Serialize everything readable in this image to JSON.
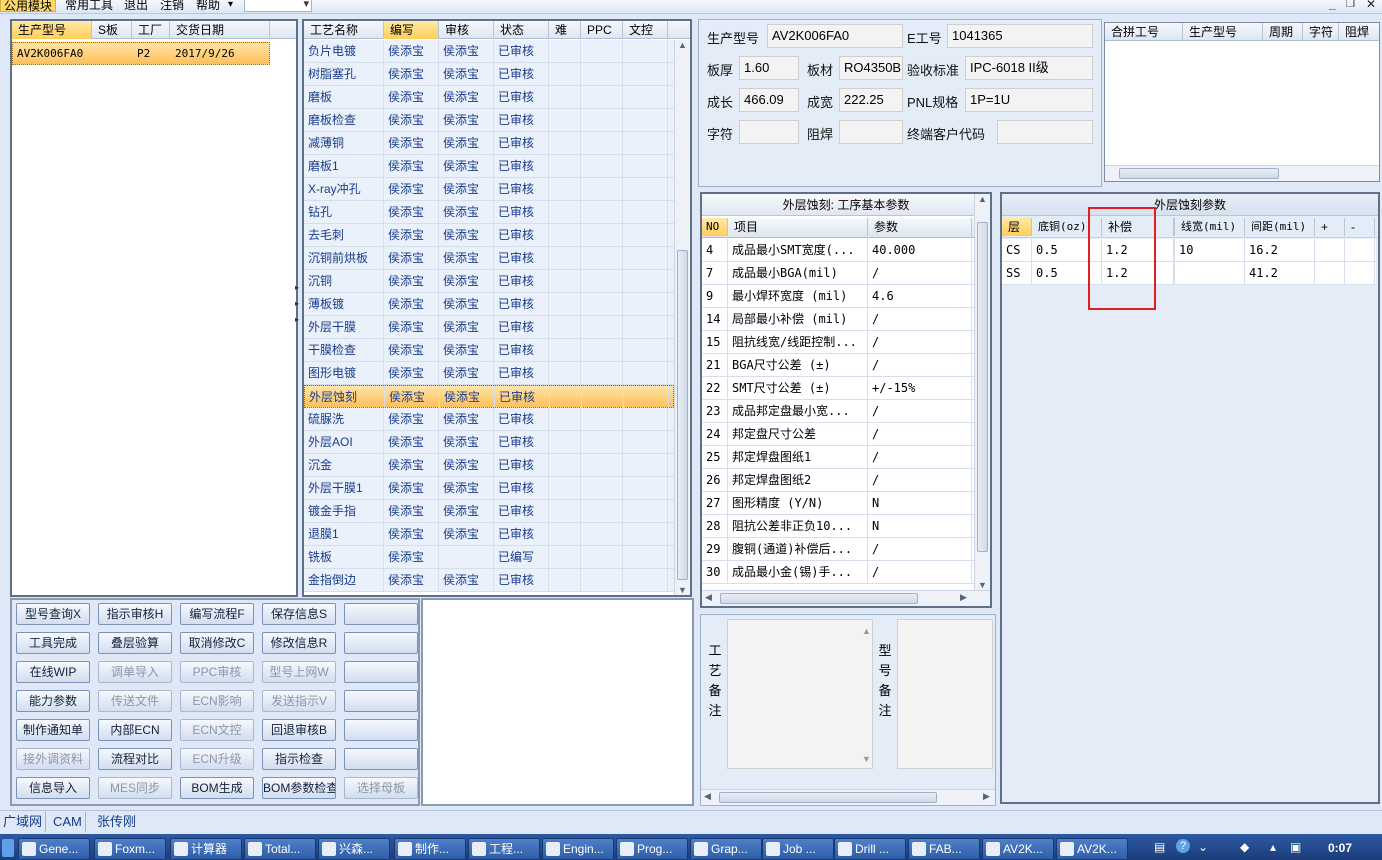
{
  "menu": {
    "items": [
      "公用模块",
      "常用工具",
      "退出",
      "注销",
      "帮助"
    ],
    "help_arrow": "▾"
  },
  "orders": {
    "headers": [
      "生产型号",
      "S板",
      "工厂",
      "交货日期"
    ],
    "rows": [
      {
        "model": "AV2K006FA0",
        "s": "",
        "factory": "P2",
        "date": "2017/9/26"
      }
    ]
  },
  "process": {
    "headers": [
      "工艺名称",
      "编写",
      "审核",
      "状态",
      "难",
      "PPC",
      "文控"
    ],
    "rows": [
      {
        "name": "负片电镀",
        "writer": "侯添宝",
        "reviewer": "侯添宝",
        "status": "已审核"
      },
      {
        "name": "树脂塞孔",
        "writer": "侯添宝",
        "reviewer": "侯添宝",
        "status": "已审核"
      },
      {
        "name": "磨板",
        "writer": "侯添宝",
        "reviewer": "侯添宝",
        "status": "已审核"
      },
      {
        "name": "磨板检查",
        "writer": "侯添宝",
        "reviewer": "侯添宝",
        "status": "已审核"
      },
      {
        "name": "减薄铜",
        "writer": "侯添宝",
        "reviewer": "侯添宝",
        "status": "已审核"
      },
      {
        "name": "磨板1",
        "writer": "侯添宝",
        "reviewer": "侯添宝",
        "status": "已审核"
      },
      {
        "name": "X-ray冲孔",
        "writer": "侯添宝",
        "reviewer": "侯添宝",
        "status": "已审核"
      },
      {
        "name": "钻孔",
        "writer": "侯添宝",
        "reviewer": "侯添宝",
        "status": "已审核"
      },
      {
        "name": "去毛刺",
        "writer": "侯添宝",
        "reviewer": "侯添宝",
        "status": "已审核"
      },
      {
        "name": "沉铜前烘板",
        "writer": "侯添宝",
        "reviewer": "侯添宝",
        "status": "已审核"
      },
      {
        "name": "沉铜",
        "writer": "侯添宝",
        "reviewer": "侯添宝",
        "status": "已审核"
      },
      {
        "name": "薄板镀",
        "writer": "侯添宝",
        "reviewer": "侯添宝",
        "status": "已审核"
      },
      {
        "name": "外层干膜",
        "writer": "侯添宝",
        "reviewer": "侯添宝",
        "status": "已审核"
      },
      {
        "name": "干膜检查",
        "writer": "侯添宝",
        "reviewer": "侯添宝",
        "status": "已审核"
      },
      {
        "name": "图形电镀",
        "writer": "侯添宝",
        "reviewer": "侯添宝",
        "status": "已审核"
      },
      {
        "name": "外层蚀刻",
        "writer": "侯添宝",
        "reviewer": "侯添宝",
        "status": "已审核",
        "selected": true
      },
      {
        "name": "硫脲洗",
        "writer": "侯添宝",
        "reviewer": "侯添宝",
        "status": "已审核"
      },
      {
        "name": "外层AOI",
        "writer": "侯添宝",
        "reviewer": "侯添宝",
        "status": "已审核"
      },
      {
        "name": "沉金",
        "writer": "侯添宝",
        "reviewer": "侯添宝",
        "status": "已审核"
      },
      {
        "name": "外层干膜1",
        "writer": "侯添宝",
        "reviewer": "侯添宝",
        "status": "已审核"
      },
      {
        "name": "镀金手指",
        "writer": "侯添宝",
        "reviewer": "侯添宝",
        "status": "已审核"
      },
      {
        "name": "退膜1",
        "writer": "侯添宝",
        "reviewer": "侯添宝",
        "status": "已审核"
      },
      {
        "name": "铣板",
        "writer": "侯添宝",
        "reviewer": "",
        "status": "已编写"
      },
      {
        "name": "金指倒边",
        "writer": "侯添宝",
        "reviewer": "侯添宝",
        "status": "已审核"
      }
    ]
  },
  "buttons": [
    {
      "label": "型号查询X",
      "enabled": true
    },
    {
      "label": "指示审核H",
      "enabled": true
    },
    {
      "label": "编写流程F",
      "enabled": true
    },
    {
      "label": "保存信息S",
      "enabled": true
    },
    {
      "label": "",
      "enabled": true
    },
    {
      "label": "工具完成",
      "enabled": true
    },
    {
      "label": "叠层验算",
      "enabled": true
    },
    {
      "label": "取消修改C",
      "enabled": true
    },
    {
      "label": "修改信息R",
      "enabled": true
    },
    {
      "label": "",
      "enabled": true
    },
    {
      "label": "在线WIP",
      "enabled": true
    },
    {
      "label": "调单导入",
      "enabled": false
    },
    {
      "label": "PPC审核",
      "enabled": false
    },
    {
      "label": "型号上网W",
      "enabled": false
    },
    {
      "label": "",
      "enabled": true
    },
    {
      "label": "能力参数",
      "enabled": true
    },
    {
      "label": "传送文件",
      "enabled": false
    },
    {
      "label": "ECN影响",
      "enabled": false
    },
    {
      "label": "发送指示V",
      "enabled": false
    },
    {
      "label": "",
      "enabled": true
    },
    {
      "label": "制作通知单",
      "enabled": true
    },
    {
      "label": "内部ECN",
      "enabled": true
    },
    {
      "label": "ECN文控",
      "enabled": false
    },
    {
      "label": "回退审核B",
      "enabled": true
    },
    {
      "label": "",
      "enabled": true
    },
    {
      "label": "接外调资料",
      "enabled": false
    },
    {
      "label": "流程对比",
      "enabled": true
    },
    {
      "label": "ECN升级",
      "enabled": false
    },
    {
      "label": "指示检查",
      "enabled": true
    },
    {
      "label": "",
      "enabled": true
    },
    {
      "label": "信息导入",
      "enabled": true
    },
    {
      "label": "MES同步",
      "enabled": false
    },
    {
      "label": "BOM生成",
      "enabled": true
    },
    {
      "label": "BOM参数检查",
      "enabled": true
    },
    {
      "label": "选择母板",
      "enabled": false
    }
  ],
  "info": {
    "model_label": "生产型号",
    "model_value": "AV2K006FA0",
    "ework_label": "E工号",
    "ework_value": "1041365",
    "thick_label": "板厚",
    "thick_value": "1.60",
    "material_label": "板材",
    "material_value": "RO4350B",
    "accept_label": "验收标准",
    "accept_value": "IPC-6018 II级",
    "length_label": "成长",
    "length_value": "466.09",
    "width_label": "成宽",
    "width_value": "222.25",
    "pnl_label": "PNL规格",
    "pnl_value": "1P=1U",
    "char_label": "字符",
    "char_value": "",
    "mask_label": "阻焊",
    "mask_value": "",
    "customer_label": "终端客户代码",
    "customer_value": ""
  },
  "combined": {
    "headers": [
      "合拼工号",
      "生产型号",
      "周期",
      "字符",
      "阻焊"
    ]
  },
  "params": {
    "title": "外层蚀刻: 工序基本参数",
    "headers": [
      "NO",
      "项目",
      "参数"
    ],
    "rows": [
      {
        "no": "4",
        "item": "成品最小SMT宽度(...",
        "value": "40.000"
      },
      {
        "no": "7",
        "item": "成品最小BGA(mil)",
        "value": "/"
      },
      {
        "no": "9",
        "item": "最小焊环宽度 (mil)",
        "value": "4.6"
      },
      {
        "no": "14",
        "item": "局部最小补偿 (mil)",
        "value": "/"
      },
      {
        "no": "15",
        "item": "阻抗线宽/线距控制...",
        "value": "/"
      },
      {
        "no": "21",
        "item": "BGA尺寸公差 (±)",
        "value": "/"
      },
      {
        "no": "22",
        "item": "SMT尺寸公差 (±)",
        "value": "+/-15%"
      },
      {
        "no": "23",
        "item": "成品邦定盘最小宽...",
        "value": "/"
      },
      {
        "no": "24",
        "item": "邦定盘尺寸公差",
        "value": "/"
      },
      {
        "no": "25",
        "item": "邦定焊盘图纸1",
        "value": "/"
      },
      {
        "no": "26",
        "item": "邦定焊盘图纸2",
        "value": "/"
      },
      {
        "no": "27",
        "item": "图形精度 (Y/N)",
        "value": "N"
      },
      {
        "no": "28",
        "item": "阻抗公差非正负10...",
        "value": "N"
      },
      {
        "no": "29",
        "item": "腹铜(通道)补偿后...",
        "value": "/"
      },
      {
        "no": "30",
        "item": "成品最小金(锡)手...",
        "value": "/"
      }
    ]
  },
  "etch": {
    "title": "外层蚀刻参数",
    "headers": [
      "层",
      "底铜(oz)",
      "补偿",
      "",
      "线宽(mil)",
      "间距(mil)",
      "+",
      "-"
    ],
    "rows": [
      {
        "layer": "CS",
        "copper": "0.5",
        "comp": "1.2",
        "blank": "",
        "width": "10",
        "space": "16.2",
        "plus": "",
        "minus": ""
      },
      {
        "layer": "SS",
        "copper": "0.5",
        "comp": "1.2",
        "blank": "",
        "width": "",
        "space": "41.2",
        "plus": "",
        "minus": ""
      }
    ],
    "highlight_color": "#e02020"
  },
  "notes": {
    "process_label": "工艺备注",
    "model_label": "型号备注"
  },
  "tabs": [
    "广域网",
    "CAM",
    "张传刚"
  ],
  "taskbar": {
    "items": [
      "Gene...",
      "Foxm...",
      "计算器",
      "Total...",
      "兴森...",
      "制作...",
      "工程...",
      "Engin...",
      "Prog...",
      "Grap...",
      "Job ...",
      "Drill ...",
      "FAB...",
      "AV2K...",
      "AV2K..."
    ],
    "clock": "0:07"
  }
}
